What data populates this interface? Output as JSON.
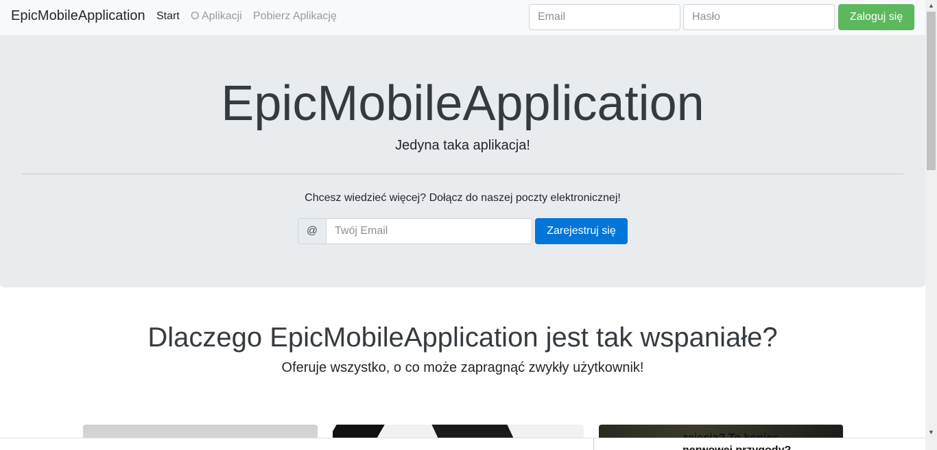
{
  "navbar": {
    "brand": "EpicMobileApplication",
    "links": [
      "Start",
      "O Aplikacji",
      "Pobierz Aplikację"
    ],
    "email_placeholder": "Email",
    "password_placeholder": "Hasło",
    "login_label": "Zaloguj się"
  },
  "hero": {
    "title": "EpicMobileApplication",
    "subtitle": "Jedyna taka aplikacja!",
    "lead": "Chcesz wiedzieć więcej? Dołącz do naszej poczty elektronicznej!",
    "prepend": "@",
    "email_placeholder": "Twój Email",
    "register_label": "Zarejestruj się"
  },
  "features": {
    "title": "Dlaczego EpicMobileApplication jest tak wspaniałe?",
    "subtitle": "Oferuje wszystko, o co może zapragnąć zwykły użytkownik!",
    "card3_text_line1": "zajęcia? To koniec",
    "card3_text_line2": "nerwowej przygody?"
  },
  "colors": {
    "navbar_bg": "#f8f9fa",
    "jumbotron_bg": "#e9ecef",
    "login_button": "#5cb85c",
    "register_button": "#0275d8"
  },
  "icons": {
    "scroll_up": "triangle-up-icon",
    "scroll_down": "triangle-down-icon"
  }
}
